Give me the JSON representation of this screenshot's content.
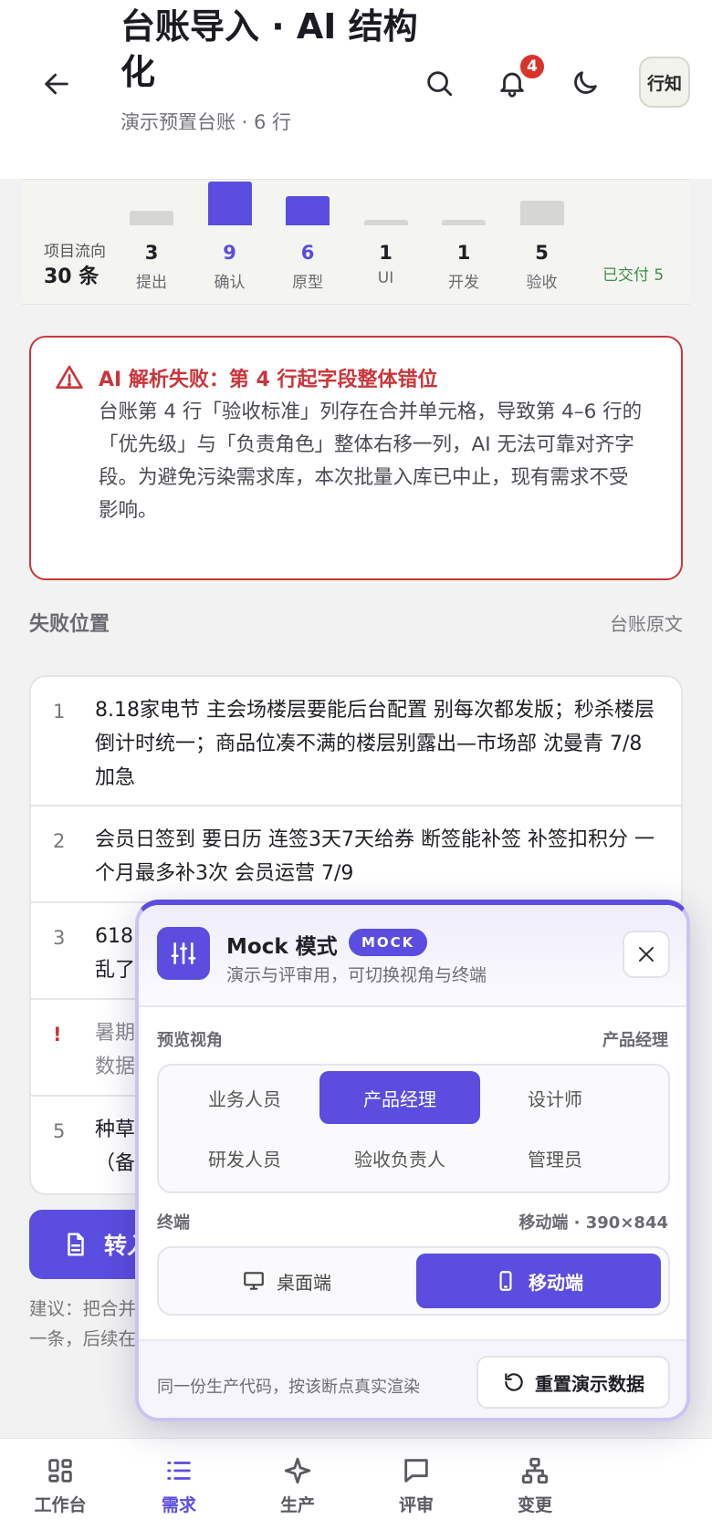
{
  "header": {
    "title": "台账导入 · AI 结构化",
    "subtitle": "演示预置台账 · 6 行",
    "notification_count": "4",
    "avatar_text": "行知",
    "icons": [
      "back-arrow-icon",
      "search-icon",
      "bell-icon",
      "moon-icon"
    ]
  },
  "flow": {
    "label": "项目流向",
    "total": "30 条",
    "stages": [
      {
        "name": "提出",
        "count": "3",
        "value": 3,
        "active": false
      },
      {
        "name": "确认",
        "count": "9",
        "value": 9,
        "active": true
      },
      {
        "name": "原型",
        "count": "6",
        "value": 6,
        "active": true
      },
      {
        "name": "UI",
        "count": "1",
        "value": 1,
        "active": false
      },
      {
        "name": "开发",
        "count": "1",
        "value": 1,
        "active": false
      },
      {
        "name": "验收",
        "count": "5",
        "value": 5,
        "active": false
      }
    ],
    "delivered": "已交付 5"
  },
  "error": {
    "title": "AI 解析失败：第 4 行起字段整体错位",
    "body": "台账第 4 行「验收标准」列存在合并单元格，导致第 4–6 行的「优先级」与「负责角色」整体右移一列，AI 无法可靠对齐字段。为避免污染需求库，本次批量入库已中止，现有需求不受影响。",
    "color": "#c9363b"
  },
  "section": {
    "label": "失败位置",
    "link": "台账原文"
  },
  "rows": [
    {
      "index": "1",
      "text": "8.18家电节 主会场楼层要能后台配置 别每次都发版；秒杀楼层倒计时统一；商品位凑不满的楼层别露出—市场部 沈曼青 7/8 加急"
    },
    {
      "index": "2",
      "text": "会员日签到 要日历 连签3天7天给券 断签能补签 补签扣积分 一个月最多补3次 会员运营 7/9"
    },
    {
      "index": "3",
      "text": "618"
    },
    {
      "index": "3b",
      "text": "乱了"
    },
    {
      "index": "!",
      "text": "暑期"
    },
    {
      "index": "4b",
      "text": "数据"
    },
    {
      "index": "5",
      "text": "种草"
    },
    {
      "index": "5b",
      "text": "（备"
    }
  ],
  "convert_button": "转入",
  "hint": {
    "line1": "建议：把合并",
    "line2": "一条，后续在"
  },
  "mock": {
    "title": "Mock 模式",
    "tag": "MOCK",
    "subtitle": "演示与评审用，可切换视角与终端",
    "view_label": "预览视角",
    "view_value": "产品经理",
    "roles": [
      "业务人员",
      "产品经理",
      "设计师",
      "研发人员",
      "验收负责人",
      "管理员"
    ],
    "selected_role": "产品经理",
    "terminal_label": "终端",
    "terminal_value": "移动端 · 390×844",
    "terminals": [
      "桌面端",
      "移动端"
    ],
    "selected_terminal": "移动端",
    "footer_note": "同一份生产代码，按该断点真实渲染",
    "reset_label": "重置演示数据",
    "accent": "#5b4de0"
  },
  "nav": [
    {
      "label": "工作台",
      "icon": "grid-icon",
      "active": false
    },
    {
      "label": "需求",
      "icon": "list-icon",
      "active": true
    },
    {
      "label": "生产",
      "icon": "sparkle-icon",
      "active": false
    },
    {
      "label": "评审",
      "icon": "chat-icon",
      "active": false
    },
    {
      "label": "变更",
      "icon": "tree-icon",
      "active": false
    }
  ]
}
